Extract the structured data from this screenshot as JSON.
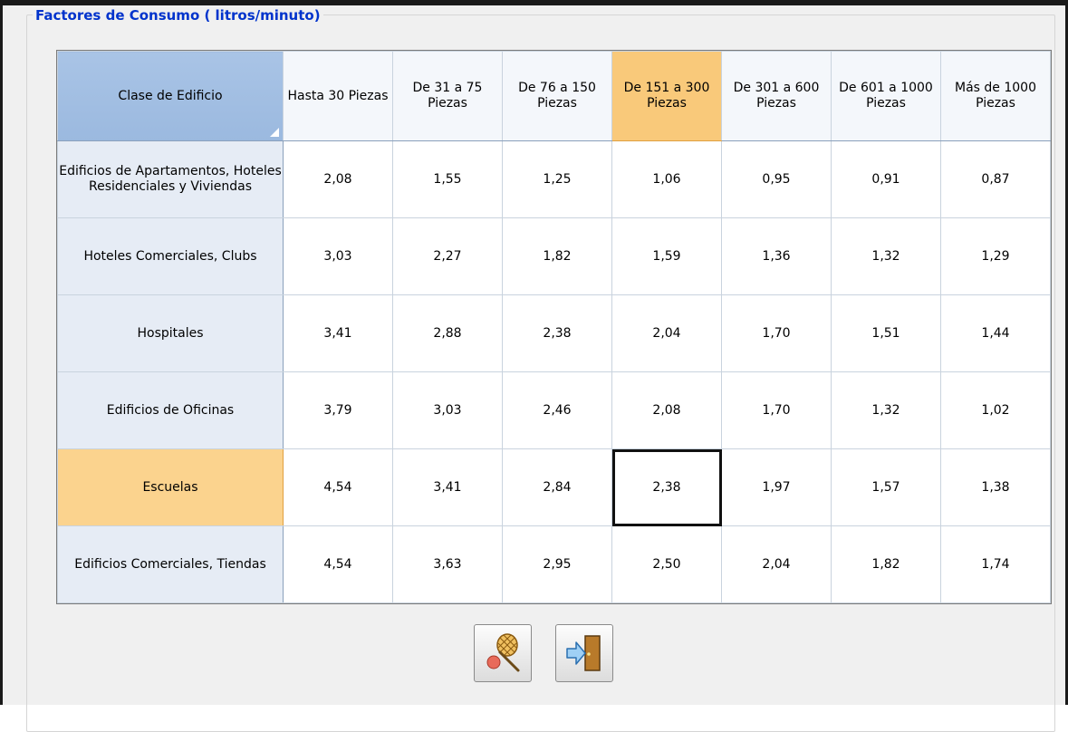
{
  "group": {
    "title": "Factores de Consumo ( litros/minuto)"
  },
  "table": {
    "corner_header": "Clase de Edificio",
    "columns": [
      "Hasta 30 Piezas",
      "De 31 a 75 Piezas",
      "De 76 a 150 Piezas",
      "De 151 a 300 Piezas",
      "De 301 a 600 Piezas",
      "De 601 a 1000 Piezas",
      "Más de 1000 Piezas"
    ],
    "selected_column": 3,
    "selected_row": 4,
    "rows": [
      {
        "label": "Edificios de Apartamentos, Hoteles Residenciales y Viviendas",
        "values": [
          "2,08",
          "1,55",
          "1,25",
          "1,06",
          "0,95",
          "0,91",
          "0,87"
        ]
      },
      {
        "label": "Hoteles Comerciales, Clubs",
        "values": [
          "3,03",
          "2,27",
          "1,82",
          "1,59",
          "1,36",
          "1,32",
          "1,29"
        ]
      },
      {
        "label": "Hospitales",
        "values": [
          "3,41",
          "2,88",
          "2,38",
          "2,04",
          "1,70",
          "1,51",
          "1,44"
        ]
      },
      {
        "label": "Edificios de Oficinas",
        "values": [
          "3,79",
          "3,03",
          "2,46",
          "2,08",
          "1,70",
          "1,32",
          "1,02"
        ]
      },
      {
        "label": "Escuelas",
        "values": [
          "4,54",
          "3,41",
          "2,84",
          "2,38",
          "1,97",
          "1,57",
          "1,38"
        ]
      },
      {
        "label": "Edificios Comerciales, Tiendas",
        "values": [
          "4,54",
          "3,63",
          "2,95",
          "2,50",
          "2,04",
          "1,82",
          "1,74"
        ]
      }
    ]
  },
  "buttons": [
    {
      "icon": "net-icon"
    },
    {
      "icon": "exit-door-icon"
    }
  ],
  "colors": {
    "group_title": "#0033cc",
    "header_selected": "#f9c97a",
    "row_header": "#e6ecf5",
    "corner_header": "#a9c4e6"
  }
}
